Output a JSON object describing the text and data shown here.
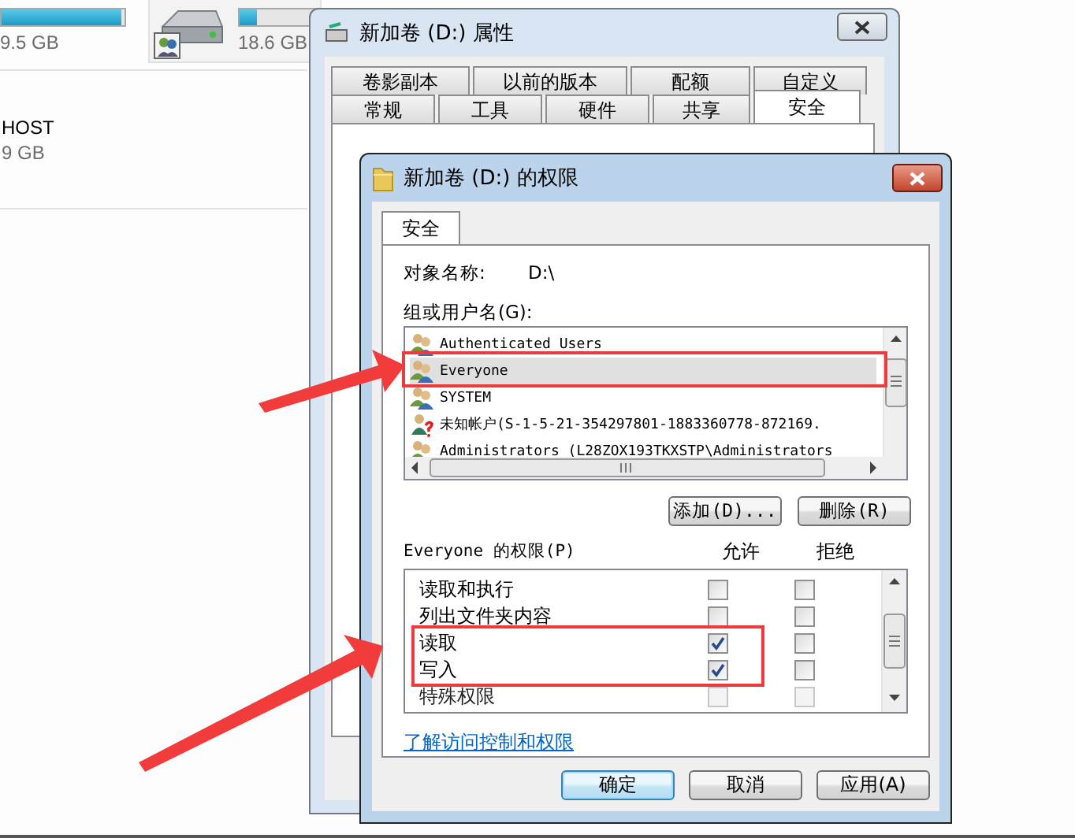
{
  "explorer": {
    "drives": [
      {
        "size": "9.5 GB",
        "level": 0.97,
        "icon": false
      },
      {
        "size": "18.6 GB",
        "level": 0.22,
        "icon": true
      }
    ],
    "network": {
      "name": "HOST",
      "size": "9 GB"
    }
  },
  "properties_dialog": {
    "title": "新加卷 (D:) 属性",
    "tab_rows": [
      [
        {
          "label": "卷影副本",
          "selected": false
        },
        {
          "label": "以前的版本",
          "selected": false
        },
        {
          "label": "配额",
          "selected": false
        },
        {
          "label": "自定义",
          "selected": false
        }
      ],
      [
        {
          "label": "常规",
          "selected": false
        },
        {
          "label": "工具",
          "selected": false
        },
        {
          "label": "硬件",
          "selected": false
        },
        {
          "label": "共享",
          "selected": false
        },
        {
          "label": "安全",
          "selected": true
        }
      ]
    ]
  },
  "permissions_dialog": {
    "title": "新加卷 (D:) 的权限",
    "tab": "安全",
    "object_label": "对象名称:",
    "object_value": "D:\\",
    "groups_label": "组或用户名(G):",
    "users": [
      {
        "name": "Authenticated Users",
        "kind": "group",
        "selected": false
      },
      {
        "name": "Everyone",
        "kind": "group",
        "selected": true
      },
      {
        "name": "SYSTEM",
        "kind": "group",
        "selected": false
      },
      {
        "name": "未知帐户(S-1-5-21-354297801-1883360778-872169.",
        "kind": "unknown",
        "selected": false
      },
      {
        "name": "Administrators (L28ZOX193TKXSTP\\Administrators",
        "kind": "group",
        "selected": false
      }
    ],
    "user_buttons": [
      "添加(D)...",
      "删除(R)"
    ],
    "permissions_label": "Everyone 的权限(P)",
    "allow_header": "允许",
    "deny_header": "拒绝",
    "permissions": [
      {
        "name": "读取和执行",
        "allow": false,
        "deny": false,
        "disabled": false
      },
      {
        "name": "列出文件夹内容",
        "allow": false,
        "deny": false,
        "disabled": false
      },
      {
        "name": "读取",
        "allow": true,
        "deny": false,
        "disabled": false
      },
      {
        "name": "写入",
        "allow": true,
        "deny": false,
        "disabled": false
      },
      {
        "name": "特殊权限",
        "allow": false,
        "deny": false,
        "disabled": true
      }
    ],
    "link": "了解访问控制和权限",
    "buttons": [
      {
        "label": "确定",
        "default": true
      },
      {
        "label": "取消",
        "default": false
      },
      {
        "label": "应用(A)",
        "default": false
      }
    ]
  }
}
